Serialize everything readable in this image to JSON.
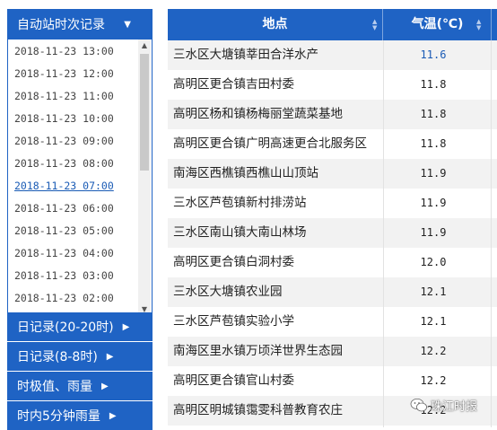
{
  "left_panel": {
    "title": "自动站时次记录",
    "title_arrow": "▼",
    "times": [
      "2018-11-23 13:00",
      "2018-11-23 12:00",
      "2018-11-23 11:00",
      "2018-11-23 10:00",
      "2018-11-23 09:00",
      "2018-11-23 08:00",
      "2018-11-23 07:00",
      "2018-11-23 06:00",
      "2018-11-23 05:00",
      "2018-11-23 04:00",
      "2018-11-23 03:00",
      "2018-11-23 02:00"
    ],
    "selected_time": "2018-11-23 07:00",
    "menu": [
      {
        "label": "日记录(20-20时)",
        "arrow": "▶"
      },
      {
        "label": "日记录(8-8时)",
        "arrow": "▶"
      },
      {
        "label": "时极值、雨量",
        "arrow": "▶"
      },
      {
        "label": "时内5分钟雨量",
        "arrow": "▶"
      }
    ]
  },
  "table": {
    "headers": {
      "location": "地点",
      "temperature": "气温(℃)"
    },
    "rows": [
      {
        "location": "三水区大塘镇莘田合洋水产",
        "temperature": "11.6"
      },
      {
        "location": "高明区更合镇吉田村委",
        "temperature": "11.8"
      },
      {
        "location": "高明区杨和镇杨梅丽堂蔬菜基地",
        "temperature": "11.8"
      },
      {
        "location": "高明区更合镇广明高速更合北服务区",
        "temperature": "11.8"
      },
      {
        "location": "南海区西樵镇西樵山山顶站",
        "temperature": "11.9"
      },
      {
        "location": "三水区芦苞镇新村排涝站",
        "temperature": "11.9"
      },
      {
        "location": "三水区南山镇大南山林场",
        "temperature": "11.9"
      },
      {
        "location": "高明区更合镇白洞村委",
        "temperature": "12.0"
      },
      {
        "location": "三水区大塘镇农业园",
        "temperature": "12.1"
      },
      {
        "location": "三水区芦苞镇实验小学",
        "temperature": "12.1"
      },
      {
        "location": "南海区里水镇万顷洋世界生态园",
        "temperature": "12.2"
      },
      {
        "location": "高明区更合镇官山村委",
        "temperature": "12.2"
      },
      {
        "location": "高明区明城镇霭雯科普教育农庄",
        "temperature": "12.2"
      }
    ]
  },
  "watermark": {
    "text": "珠江时报",
    "icon": "wechat-icon"
  },
  "colors": {
    "accent": "#1f63c4",
    "link": "#1a5bb5",
    "row_alt": "#f2f2f2"
  }
}
